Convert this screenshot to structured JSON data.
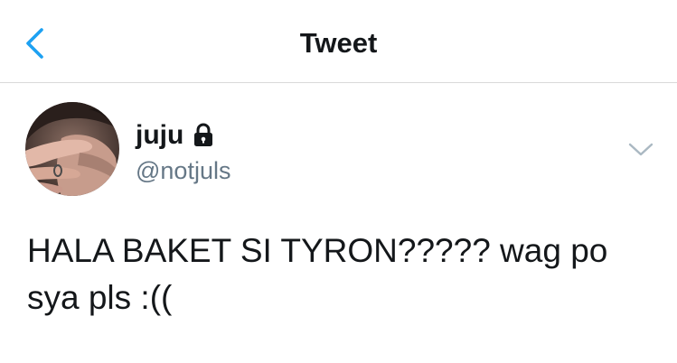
{
  "nav": {
    "title": "Tweet",
    "back_icon": "chevron-left-icon",
    "accent_color": "#1da1f2"
  },
  "tweet": {
    "author": {
      "display_name": "juju",
      "handle": "@notjuls",
      "protected_icon": "lock-icon"
    },
    "menu_icon": "chevron-down-icon",
    "text": "HALA BAKET SI TYRON????? wag po sya pls :(("
  }
}
